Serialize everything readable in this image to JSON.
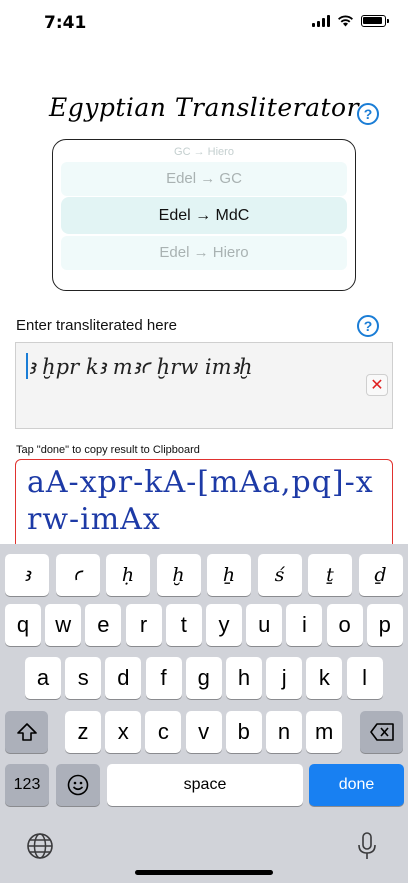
{
  "status": {
    "time": "7:41"
  },
  "app": {
    "title": "Egyptian Transliterator",
    "help_glyph": "?"
  },
  "picker": {
    "faint_top": "GC → Hiero",
    "option_above": "Edel → GC",
    "selected": "Edel → MdC",
    "option_below": "Edel → Hiero"
  },
  "input_section": {
    "label": "Enter transliterated here",
    "value": "ꜣ ḫpr kꜣ mꜣꜥ ḫrw imꜣḫ",
    "clear_glyph": "✕"
  },
  "output_section": {
    "hint": "Tap \"done\" to copy result to Clipboard",
    "value": "aA-xpr-kA-[mAa,pq]-xrw-imAx"
  },
  "keyboard": {
    "row_translit": [
      "ꜣ",
      "ꜥ",
      "ḥ",
      "ḫ",
      "ẖ",
      "ś",
      "ṯ",
      "ḏ"
    ],
    "row1": [
      "q",
      "w",
      "e",
      "r",
      "t",
      "y",
      "u",
      "i",
      "o",
      "p"
    ],
    "row2": [
      "a",
      "s",
      "d",
      "f",
      "g",
      "h",
      "j",
      "k",
      "l"
    ],
    "row3": [
      "z",
      "x",
      "c",
      "v",
      "b",
      "n",
      "m"
    ],
    "numbers_label": "123",
    "space_label": "space",
    "done_label": "done",
    "icons": [
      "shift-icon",
      "backspace-icon",
      "emoji-icon",
      "globe-icon",
      "microphone-icon"
    ]
  },
  "colors": {
    "accent": "#1a7dd6",
    "done_key": "#1880f2",
    "output_text": "#1d3aa6",
    "output_border": "#e0322f",
    "clear_x": "#e02020"
  }
}
